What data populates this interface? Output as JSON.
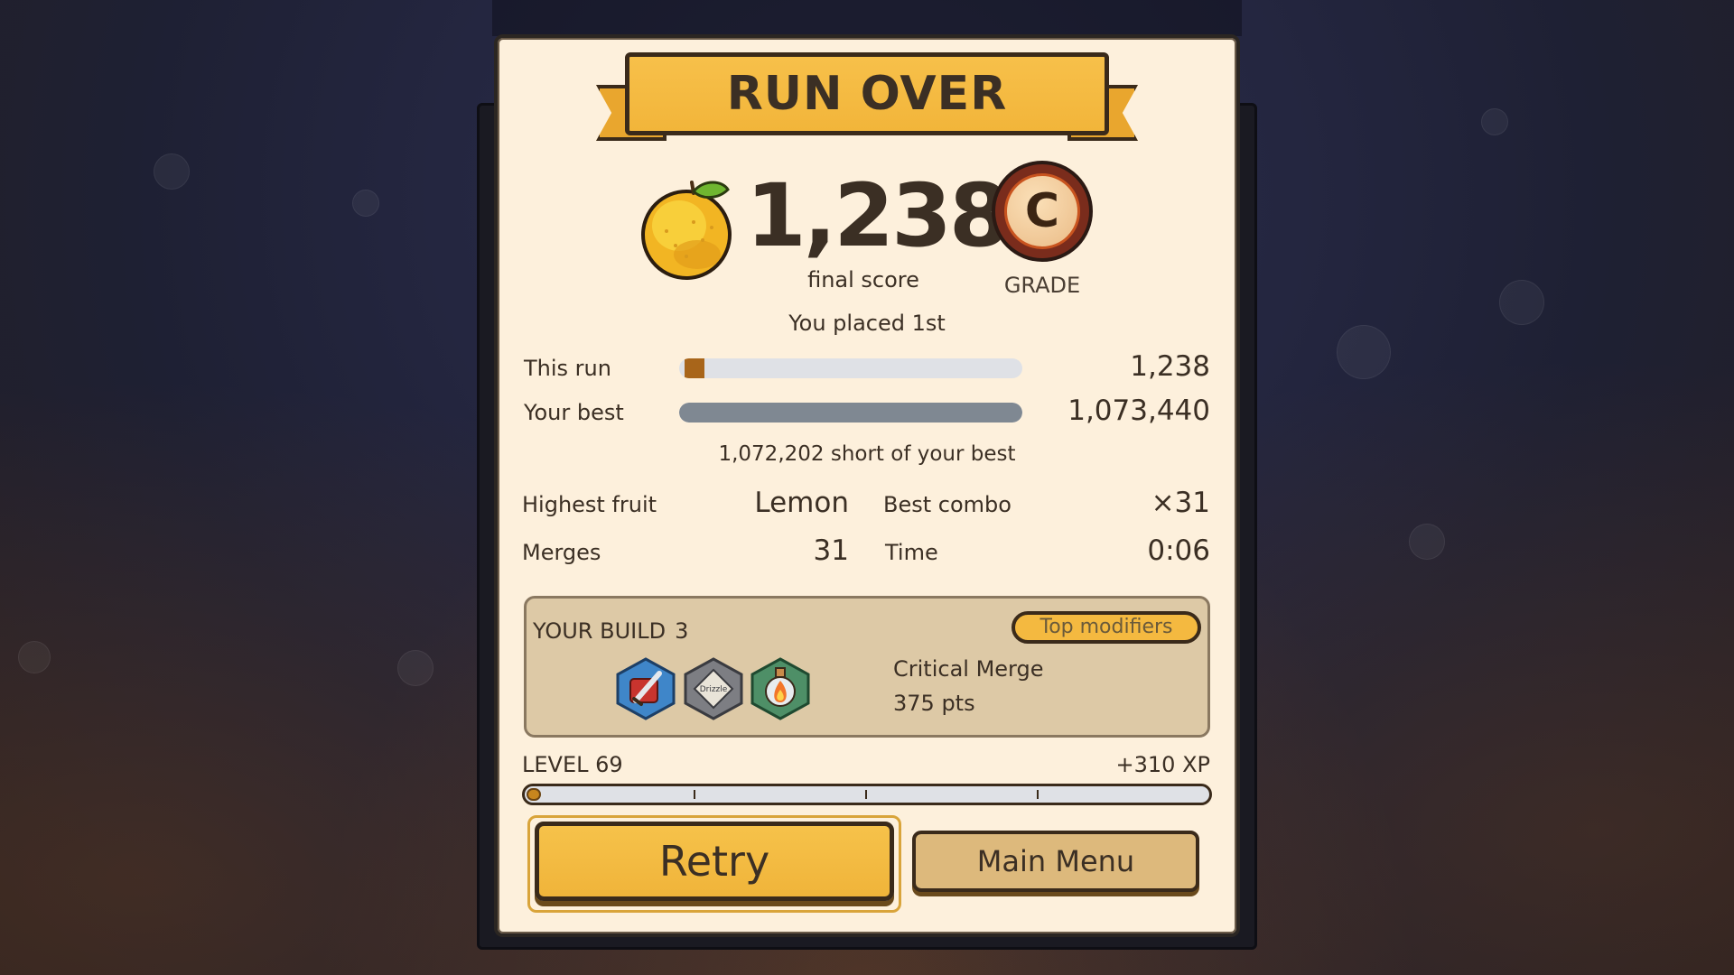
{
  "banner": {
    "title": "RUN OVER"
  },
  "score": {
    "value": "1,238",
    "label": "final score",
    "fruit_icon": "lemon-icon"
  },
  "grade": {
    "letter": "C",
    "label": "GRADE"
  },
  "placement": "You placed 1st",
  "comparison": {
    "this_run_label": "This run",
    "this_run_value": "1,238",
    "this_run_fraction": 0.0012,
    "best_label": "Your best",
    "best_value": "1,073,440",
    "best_fraction": 1.0,
    "short_text": "1,072,202 short of your best"
  },
  "stats": {
    "highest_fruit_label": "Highest fruit",
    "highest_fruit_value": "Lemon",
    "best_combo_label": "Best combo",
    "best_combo_value": "×31",
    "merges_label": "Merges",
    "merges_value": "31",
    "time_label": "Time",
    "time_value": "0:06"
  },
  "build": {
    "title": "YOUR BUILD",
    "count": "3",
    "top_modifiers_label": "Top modifiers",
    "modifiers": [
      {
        "icon": "sword-icon",
        "color": "#3f86c9"
      },
      {
        "icon": "drizzle-icon",
        "label": "Drizzle",
        "color": "#7d7e83"
      },
      {
        "icon": "fire-potion-icon",
        "color": "#4e8f67"
      }
    ],
    "top_modifier_name": "Critical Merge",
    "top_modifier_points": "375 pts"
  },
  "level": {
    "label": "LEVEL 69",
    "xp_gain": "+310 XP",
    "progress_fraction": 0.01
  },
  "buttons": {
    "retry": "Retry",
    "main_menu": "Main Menu"
  },
  "colors": {
    "panel_bg": "#fdf0dc",
    "accent_gold": "#f2b53a",
    "grade_ring": "#7a2c1c",
    "build_bg": "#ddc9a6"
  }
}
